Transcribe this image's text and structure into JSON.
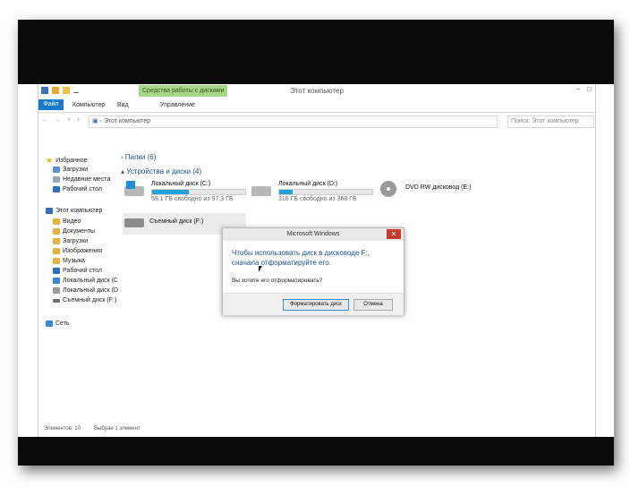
{
  "titlebar": {
    "tools_tab": "Средства работы с дисками",
    "title": "Этот компьютер"
  },
  "ribbon": {
    "tabs": [
      "Файл",
      "Компьютер",
      "Вид",
      "Управление"
    ]
  },
  "address": {
    "path": "Этот компьютер",
    "search_placeholder": "Поиск: Этот компьютер"
  },
  "nav": {
    "favorites": "Избранное",
    "fav_items": [
      "Загрузки",
      "Недавние места",
      "Рабочий стол"
    ],
    "this_pc": "Этот компьютер",
    "pc_items": [
      "Видео",
      "Документы",
      "Загрузки",
      "Изображения",
      "Музыка",
      "Рабочий стол",
      "Локальный диск (C",
      "Локальный диск (D",
      "Съемный диск (F:)"
    ],
    "network": "Сеть"
  },
  "content": {
    "folders_header": "Папки (6)",
    "devices_header": "Устройства и диски (4)",
    "drives": [
      {
        "name": "Локальный диск (C:)",
        "size": "59,1 ГБ свободно из 97,3 ГБ",
        "used_fraction": 0.39
      },
      {
        "name": "Локальный диск (D:)",
        "size": "316 ГБ свободно из 368 ГБ",
        "used_fraction": 0.14
      },
      {
        "name": "DVD RW дисковод (E:)"
      },
      {
        "name": "Съемный диск (F:)"
      }
    ]
  },
  "status": {
    "items_count": "Элементов: 10",
    "selected": "Выбран 1 элемент"
  },
  "dialog": {
    "title": "Microsoft Windows",
    "close": "✕",
    "message": "Чтобы использовать диск в дисководе F:, сначала отформатируйте его.",
    "question": "Вы хотите его отформатировать?",
    "format_button": "Форматировать диск",
    "cancel_button": "Отмена"
  },
  "colors": {
    "accent": "#1979ca",
    "bar_fill": "#26a0da",
    "tools_tab": "#a9d68a",
    "close": "#c7392f"
  }
}
